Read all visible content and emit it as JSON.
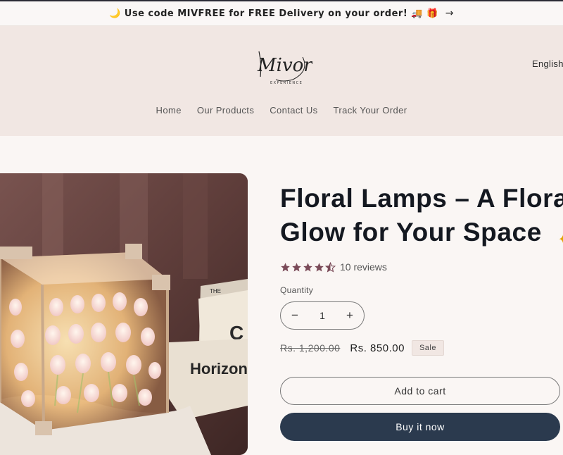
{
  "announcement": {
    "text": "🌙 Use code MIVFREE for FREE Delivery on your order! 🚚 🎁",
    "arrow": "→"
  },
  "header": {
    "logo_text": "Mivora",
    "logo_sub": "EXPERIENCE",
    "language": "English"
  },
  "nav": {
    "items": [
      "Home",
      "Our Products",
      "Contact Us",
      "Track Your Order"
    ]
  },
  "product": {
    "title_line1": "Floral Lamps – A Flora",
    "title_line2": "Glow for Your Space",
    "rating_value": 4.5,
    "reviews_label": "10 reviews",
    "quantity_label": "Quantity",
    "quantity_value": "1",
    "minus_symbol": "−",
    "plus_symbol": "+",
    "regular_price": "Rs. 1,200.00",
    "sale_price": "Rs. 850.00",
    "sale_badge": "Sale",
    "add_to_cart": "Add to cart",
    "buy_now": "Buy it now",
    "book_text_1": "Horizon",
    "book_text_2": "THE"
  },
  "colors": {
    "accent_dark": "#2b3a4e",
    "header_bg": "#f1e7e3",
    "star_color": "#7a4a58"
  }
}
